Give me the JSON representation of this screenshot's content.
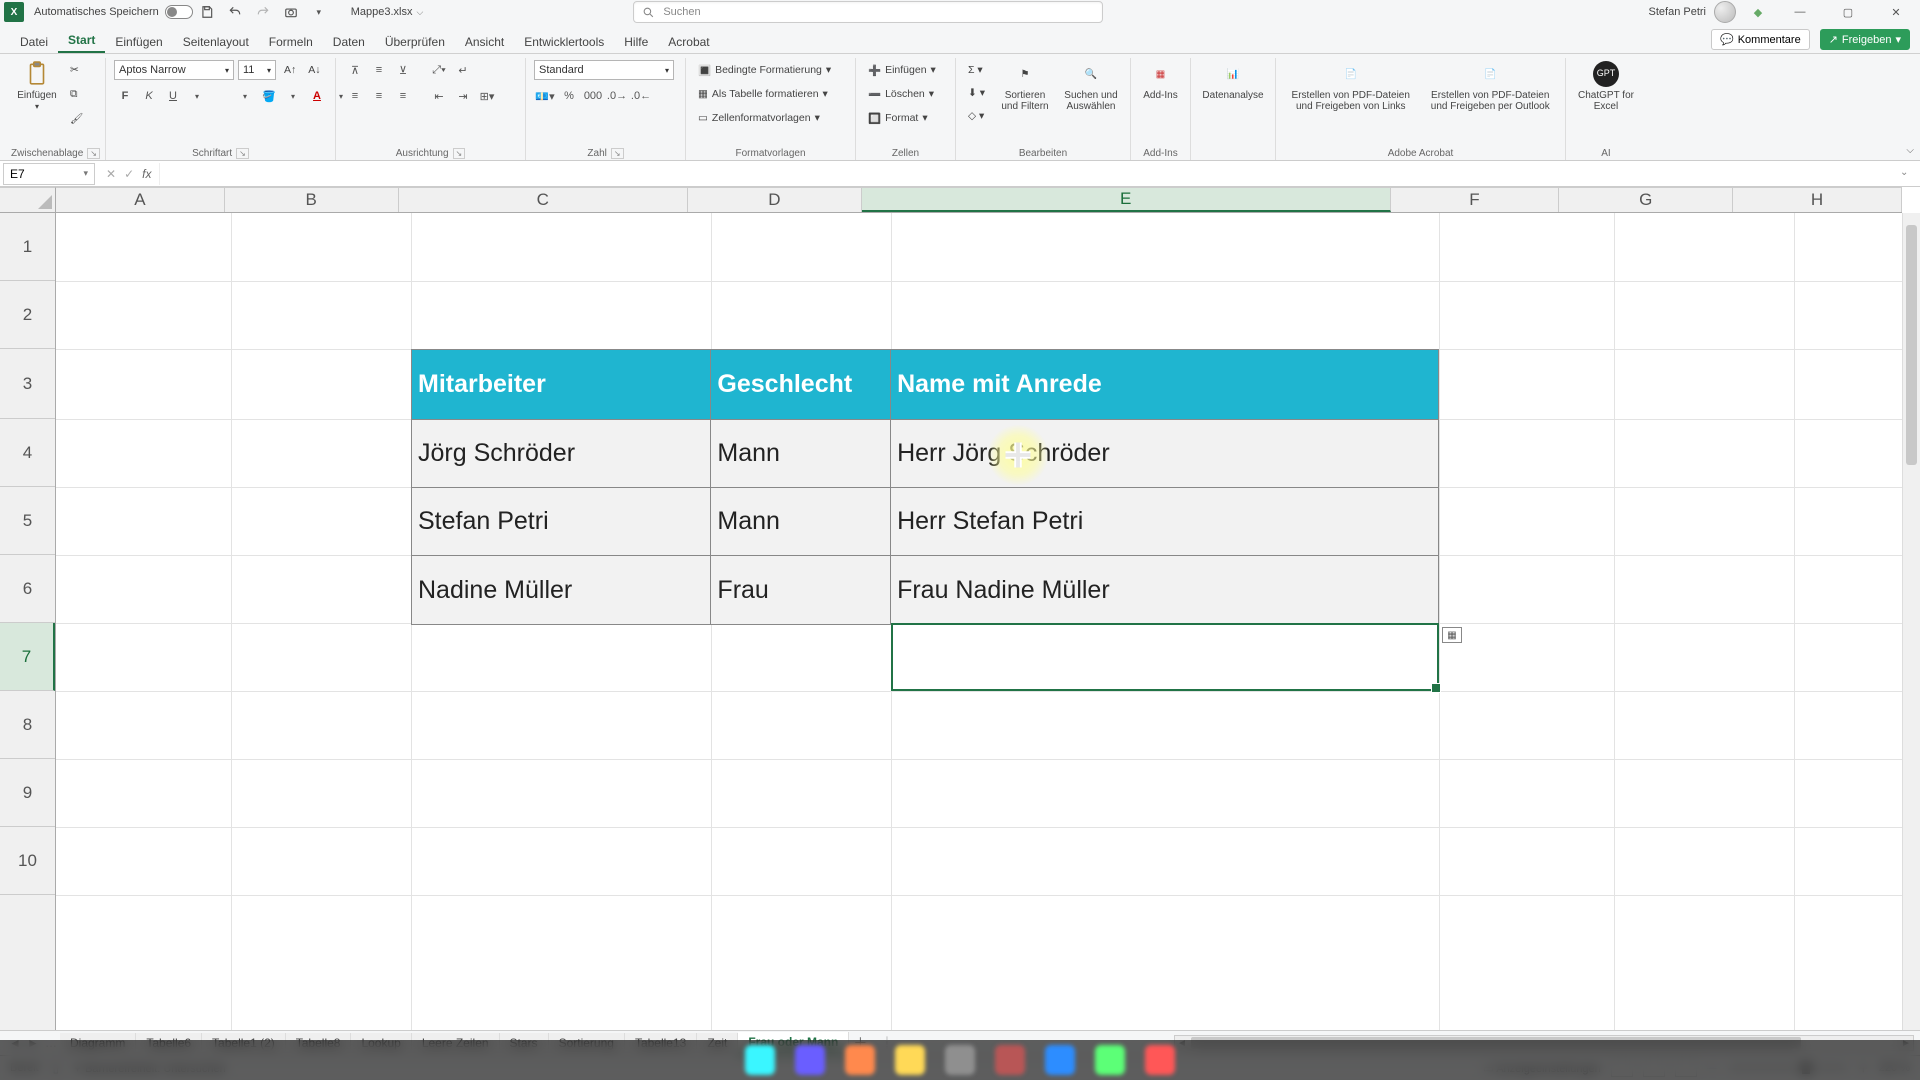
{
  "titlebar": {
    "autosave_label": "Automatisches Speichern",
    "filename": "Mappe3.xlsx",
    "search_placeholder": "Suchen",
    "user": "Stefan Petri"
  },
  "menu": {
    "tabs": [
      "Datei",
      "Start",
      "Einfügen",
      "Seitenlayout",
      "Formeln",
      "Daten",
      "Überprüfen",
      "Ansicht",
      "Entwicklertools",
      "Hilfe",
      "Acrobat"
    ],
    "active": "Start",
    "comments": "Kommentare",
    "share": "Freigeben"
  },
  "ribbon": {
    "clipboard": {
      "paste": "Einfügen",
      "label": "Zwischenablage"
    },
    "font": {
      "name": "Aptos Narrow",
      "size": "11",
      "label": "Schriftart"
    },
    "align": {
      "label": "Ausrichtung"
    },
    "number": {
      "format": "Standard",
      "label": "Zahl"
    },
    "styles": {
      "cond": "Bedingte Formatierung",
      "astable": "Als Tabelle formatieren",
      "cellstyle": "Zellenformatvorlagen",
      "label": "Formatvorlagen"
    },
    "cells": {
      "insert": "Einfügen",
      "delete": "Löschen",
      "format": "Format",
      "label": "Zellen"
    },
    "editing": {
      "sort": "Sortieren und Filtern",
      "find": "Suchen und Auswählen",
      "label": "Bearbeiten"
    },
    "addins": {
      "addin": "Add-Ins",
      "label": "Add-Ins"
    },
    "data_analysis": "Datenanalyse",
    "acrobat": {
      "a": "Erstellen von PDF-Dateien und Freigeben von Links",
      "b": "Erstellen von PDF-Dateien und Freigeben per Outlook",
      "label": "Adobe Acrobat"
    },
    "gpt": {
      "btn": "ChatGPT for Excel",
      "label": "AI"
    }
  },
  "fx": {
    "cellref": "E7",
    "formula": ""
  },
  "columns": [
    "A",
    "B",
    "C",
    "D",
    "E",
    "F",
    "G",
    "H"
  ],
  "table": {
    "headers": {
      "c": "Mitarbeiter",
      "d": "Geschlecht",
      "e": "Name mit Anrede"
    },
    "rows": [
      {
        "c": "Jörg Schröder",
        "d": "Mann",
        "e": "Herr Jörg Schröder"
      },
      {
        "c": "Stefan Petri",
        "d": "Mann",
        "e": "Herr Stefan Petri"
      },
      {
        "c": "Nadine Müller",
        "d": "Frau",
        "e": "Frau Nadine Müller"
      }
    ]
  },
  "sheets": {
    "tabs": [
      "Diagramm",
      "Tabelle6",
      "Tabelle1 (2)",
      "Tabelle8",
      "Lookup",
      "Leere Zeilen",
      "Stars",
      "Sortierung",
      "Tabelle13",
      "Zeit",
      "Frau oder Mann"
    ],
    "active": "Frau oder Mann"
  },
  "status": {
    "ready": "Bereit",
    "a11y": "Barrierefreiheit: Untersuchen",
    "display": "Anzeigeeinstellungen",
    "zoom": "220 %"
  }
}
